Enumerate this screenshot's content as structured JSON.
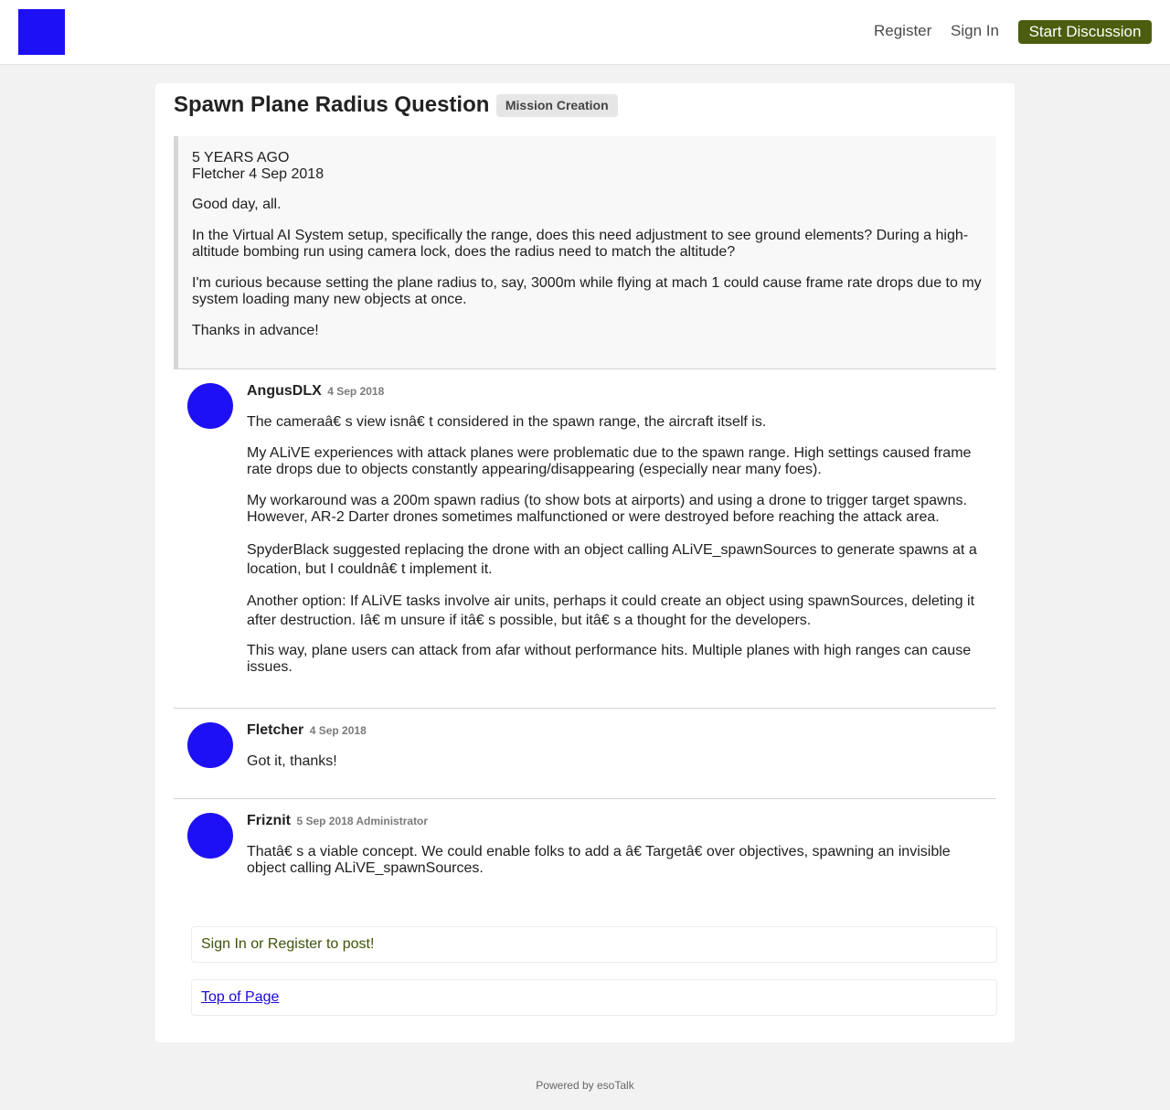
{
  "header": {
    "register_label": "Register",
    "signin_label": "Sign In",
    "start_discussion_label": "Start Discussion",
    "logo_color": "#1e10f5",
    "button_color": "#4b5e10"
  },
  "discussion": {
    "title": "Spawn Plane Radius Question",
    "channel": "Mission Creation"
  },
  "op": {
    "age": "5 YEARS AGO",
    "author_date": "Fletcher 4 Sep 2018",
    "paragraphs": [
      "Good day, all.",
      "In the Virtual AI System setup, specifically the range, does this need adjustment to see ground elements? During a high-altitude bombing run using camera lock, does the radius need to match the altitude?",
      "I'm curious because setting the plane radius to, say, 3000m while flying at mach 1 could cause frame rate drops due to my system loading many new objects at once.",
      "Thanks in advance!"
    ]
  },
  "posts": [
    {
      "author": "AngusDLX",
      "meta": "4 Sep 2018",
      "paragraphs": [
        "The cameraâ€ s view isnâ€ t considered in the spawn range, the aircraft itself is.",
        "My ALiVE experiences with attack planes were problematic due to the spawn range. High settings caused frame rate drops due to objects constantly appearing/disappearing (especially near many foes).",
        "My workaround was a 200m spawn radius (to show bots at airports) and using a drone to trigger target spawns. However, AR-2 Darter drones sometimes malfunctioned or were destroyed before reaching the attack area.",
        "SpyderBlack suggested replacing the drone with an object calling ALiVE_spawnSources to generate spawns at a location, but I couldnâ€ t implement it.",
        "Another option: If ALiVE tasks involve air units, perhaps it could create an object using spawnSources, deleting it after destruction. Iâ€ m unsure if itâ€ s possible, but itâ€ s a thought for the developers.",
        "This way, plane users can attack from afar without performance hits. Multiple planes with high ranges can cause issues."
      ]
    },
    {
      "author": "Fletcher",
      "meta": "4 Sep 2018",
      "paragraphs": [
        "Got it, thanks!"
      ]
    },
    {
      "author": "Friznit",
      "meta": "5 Sep 2018 Administrator",
      "paragraphs": [
        "Thatâ€ s a viable concept. We could enable folks to add a â€ Targetâ€  over objectives, spawning an invisible object calling ALiVE_spawnSources."
      ]
    }
  ],
  "notices": {
    "signin_register": "Sign In or Register to post!",
    "top_of_page": "Top of Page"
  },
  "footer": {
    "powered_by": "Powered by esoTalk"
  }
}
